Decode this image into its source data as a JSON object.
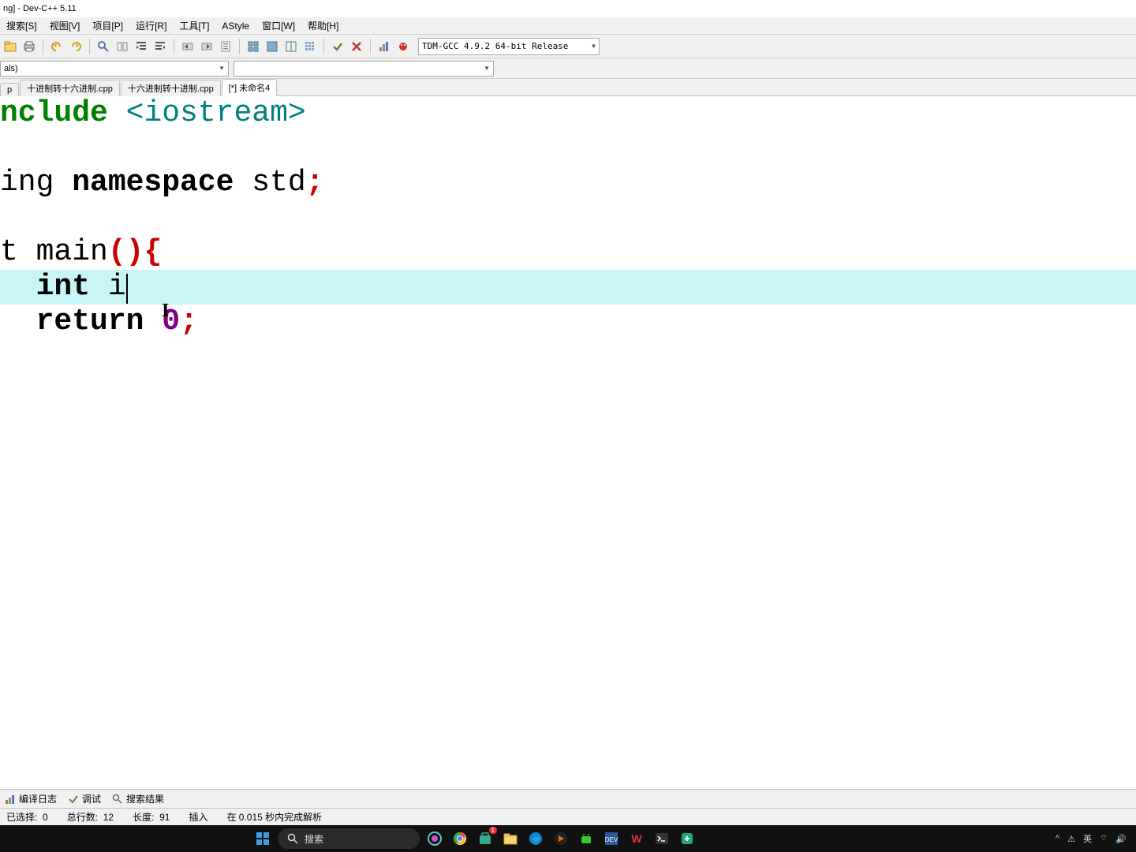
{
  "titlebar": "ng] - Dev-C++ 5.11",
  "menu": {
    "search": "搜索[S]",
    "view": "视图[V]",
    "project": "项目[P]",
    "run": "运行[R]",
    "tools": "工具[T]",
    "astyle": "AStyle",
    "window": "窗口[W]",
    "help": "帮助[H]"
  },
  "compiler_combo": "TDM-GCC 4.9.2 64-bit Release",
  "combo1": "als)",
  "tabs": {
    "t1": "p",
    "t2": "十进制转十六进制.cpp",
    "t3": "十六进制转十进制.cpp",
    "t4": "[*] 未命名4"
  },
  "code": {
    "l1_pre": "nclude ",
    "l1_inc": "<iostream>",
    "l3_a": "ing ",
    "l3_b": "namespace",
    "l3_c": " std",
    "l3_d": ";",
    "l5_a": "t ",
    "l5_b": "main",
    "l5_c": "()",
    "l5_d": "{",
    "l6_a": "  int",
    "l6_b": " i",
    "l7_a": "  return ",
    "l7_b": "0",
    "l7_c": ";"
  },
  "bottom_tabs": {
    "compile_log": "编译日志",
    "debug": "调试",
    "search_results": "搜索结果"
  },
  "status": {
    "selected_label": "已选择:",
    "selected_val": "0",
    "lines_label": "总行数:",
    "lines_val": "12",
    "length_label": "长度:",
    "length_val": "91",
    "insert": "插入",
    "parse": "在 0.015 秒内完成解析"
  },
  "taskbar": {
    "search_placeholder": "搜索",
    "lang": "英"
  }
}
